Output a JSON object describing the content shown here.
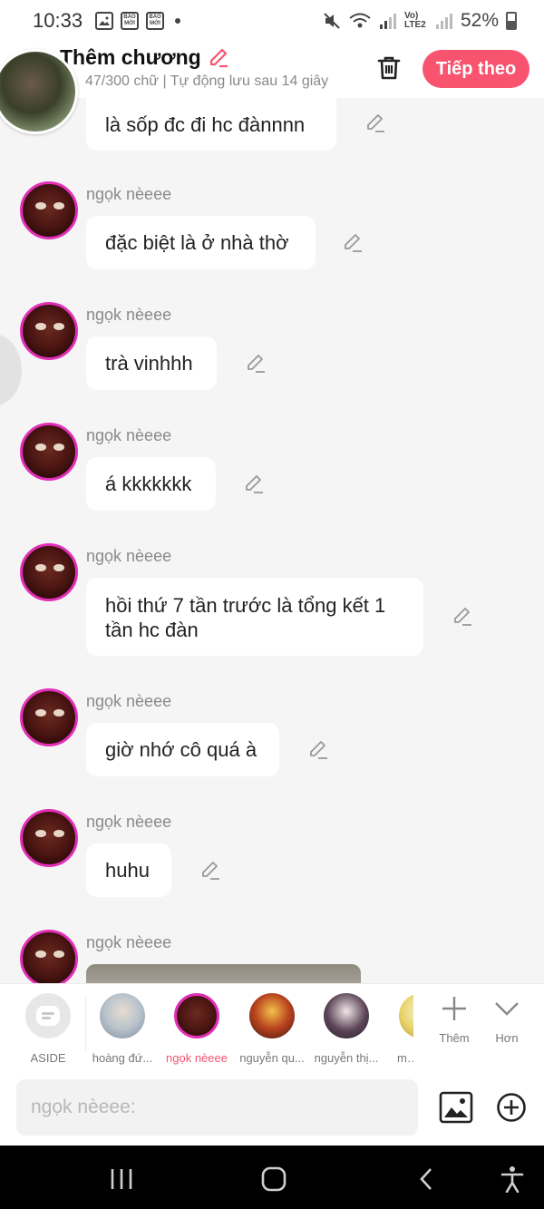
{
  "status_bar": {
    "time": "10:33",
    "app_icons": [
      "gallery-icon",
      "baomoi-icon",
      "baomoi-icon"
    ],
    "baomoi_text": "BÁO MỚI",
    "network_label": "Vo) LTE2",
    "battery": "52%"
  },
  "header": {
    "title": "Thêm chương",
    "subtitle": "47/300 chữ | Tự động lưu sau 14 giây",
    "follow_label": "Tiếp theo",
    "accent_color": "#f8536f"
  },
  "messages": [
    {
      "name": "",
      "text": "là sốp đc đi hc đànnnn"
    },
    {
      "name": "ngọk nèeee",
      "text": "đặc biệt là ở nhà thờ"
    },
    {
      "name": "ngọk nèeee",
      "text": "trà vinhhh"
    },
    {
      "name": "ngọk nèeee",
      "text": "á kkkkkkk"
    },
    {
      "name": "ngọk nèeee",
      "text": "hồi thứ 7 tần trước là tổng kết 1 tần hc đàn"
    },
    {
      "name": "ngọk nèeee",
      "text": "giờ nhớ cô quá à"
    },
    {
      "name": "ngọk nèeee",
      "text": "huhu"
    },
    {
      "name": "ngọk nèeee",
      "text": ""
    }
  ],
  "characters": [
    {
      "label": "ASIDE",
      "active": false
    },
    {
      "label": "hoàng đứ...",
      "active": false
    },
    {
      "label": "ngọk nèeee",
      "active": true
    },
    {
      "label": "nguyễn qu...",
      "active": false
    },
    {
      "label": "nguyễn thị...",
      "active": false
    },
    {
      "label": "mo",
      "active": false
    }
  ],
  "strip_actions": {
    "add_label": "Thêm",
    "more_label": "Hơn"
  },
  "input": {
    "placeholder": "ngọk nèeee:"
  }
}
